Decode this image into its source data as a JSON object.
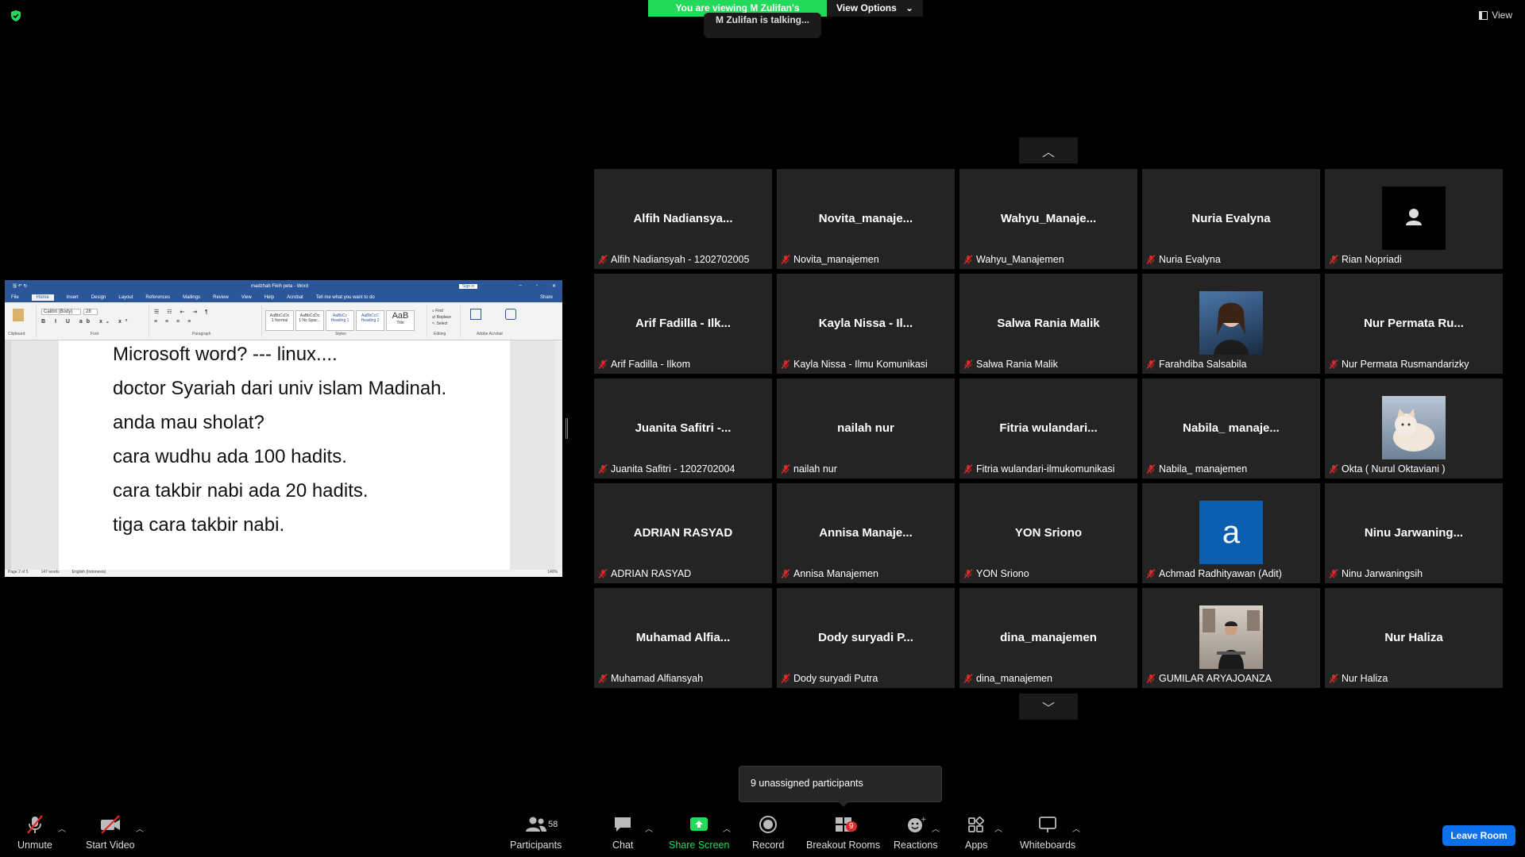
{
  "banner": {
    "viewing": "You are viewing M Zulifan's screen",
    "view_options": "View Options"
  },
  "talking": "M Zulifan is talking...",
  "view_button": "View",
  "word": {
    "title": "madzhab Fikih peta - Word",
    "sign_in": "Sign in",
    "tabs": [
      "File",
      "Home",
      "Insert",
      "Design",
      "Layout",
      "References",
      "Mailings",
      "Review",
      "View",
      "Help",
      "Acrobat",
      "Tell me what you want to do",
      "Share"
    ],
    "styles": [
      "AaBbCcDc",
      "AaBbCcDc",
      "AaBbCc",
      "AaBbCcC",
      "AaB"
    ],
    "style_names": [
      "1 Normal",
      "1 No Spac...",
      "Heading 1",
      "Heading 2",
      "Title"
    ],
    "ribbon_labels": [
      "Clipboard",
      "Font",
      "Paragraph",
      "Styles",
      "Editing",
      "Adobe Acrobat"
    ],
    "font": "Calibri (Body)",
    "size": "28",
    "lines": [
      "Microsoft word? --- linux....",
      "doctor Syariah dari univ islam Madinah.",
      "anda mau sholat?",
      "cara wudhu ada 100 hadits.",
      "cara takbir nabi ada 20 hadits.",
      "tiga cara takbir nabi."
    ],
    "status": {
      "page": "Page 2 of 5",
      "words": "147 words",
      "lang": "English (Indonesia)",
      "zoom": "140%"
    }
  },
  "participants": [
    {
      "big": "Alfih  Nadiansya...",
      "label": "Alfih Nadiansyah - 1202702005"
    },
    {
      "big": "Novita_manaje...",
      "label": "Novita_manajemen"
    },
    {
      "big": "Wahyu_Manaje...",
      "label": "Wahyu_Manajemen"
    },
    {
      "big": "Nuria Evalyna",
      "label": "Nuria Evalyna"
    },
    {
      "big": "",
      "label": "Rian Nopriadi",
      "img": "avatar"
    },
    {
      "big": "Arif Fadilla - Ilk...",
      "label": "Arif Fadilla - Ilkom"
    },
    {
      "big": "Kayla Nissa - Il...",
      "label": "Kayla Nissa - Ilmu Komunikasi"
    },
    {
      "big": "Salwa Rania Malik",
      "label": "Salwa Rania Malik"
    },
    {
      "big": "",
      "label": "Farahdiba Salsabila",
      "img": "photo-girl"
    },
    {
      "big": "Nur Permata Ru...",
      "label": "Nur Permata Rusmandarizky"
    },
    {
      "big": "Juanita Safitri -...",
      "label": "Juanita Safitri - 1202702004"
    },
    {
      "big": "nailah nur",
      "label": "nailah nur"
    },
    {
      "big": "Fitria  wulandari...",
      "label": "Fitria wulandari-ilmukomunikasi"
    },
    {
      "big": "Nabila_ manaje...",
      "label": "Nabila_ manajemen"
    },
    {
      "big": "",
      "label": "Okta ( Nurul Oktaviani )",
      "img": "photo-cat"
    },
    {
      "big": "ADRIAN RASYAD",
      "label": "ADRIAN RASYAD"
    },
    {
      "big": "Annisa  Manaje...",
      "label": "Annisa Manajemen"
    },
    {
      "big": "YON Sriono",
      "label": "YON Sriono"
    },
    {
      "big": "",
      "label": "Achmad Radhityawan (Adit)",
      "img": "letter-a",
      "letter": "a"
    },
    {
      "big": "Ninu  Jarwaning...",
      "label": "Ninu Jarwaningsih"
    },
    {
      "big": "Muhamad  Alfia...",
      "label": "Muhamad Alfiansyah"
    },
    {
      "big": "Dody  suryadi  P...",
      "label": "Dody suryadi Putra"
    },
    {
      "big": "dina_manajemen",
      "label": "dina_manajemen"
    },
    {
      "big": "",
      "label": "GUMILAR ARYAJOANZA",
      "img": "photo-man"
    },
    {
      "big": "Nur Haliza",
      "label": "Nur Haliza"
    }
  ],
  "unassigned": "9 unassigned participants",
  "toolbar": {
    "unmute": "Unmute",
    "start_video": "Start Video",
    "participants": "Participants",
    "participants_count": "58",
    "chat": "Chat",
    "share_screen": "Share Screen",
    "record": "Record",
    "breakout_rooms": "Breakout Rooms",
    "breakout_badge": "9",
    "reactions": "Reactions",
    "apps": "Apps",
    "whiteboards": "Whiteboards",
    "leave": "Leave Room"
  },
  "colors": {
    "accent_green": "#23d959",
    "leave_blue": "#0e71eb",
    "word_blue": "#2b579a",
    "tile_bg": "#242424",
    "mic_red": "#e02828"
  }
}
